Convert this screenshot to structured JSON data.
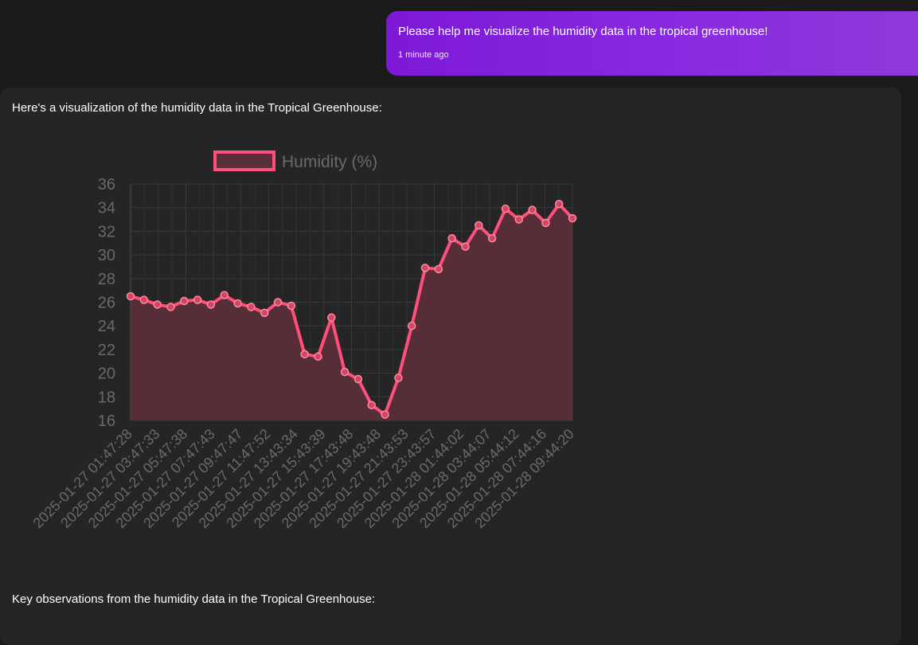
{
  "user_message": {
    "text": "Please help me visualize the humidity data in the tropical greenhouse!",
    "time": "1 minute ago"
  },
  "assistant_message": {
    "intro": "Here's a visualization of the humidity data in the Tropical Greenhouse:",
    "outro": "Key observations from the humidity data in the Tropical Greenhouse:"
  },
  "chart_data": {
    "type": "line",
    "fill": true,
    "colors": {
      "line": "#ff4f7a",
      "fill": "#5a2e38",
      "grid": "#383838",
      "tick": "#6a6a6a"
    },
    "legend": {
      "position": "top",
      "label": "Humidity (%)"
    },
    "ylim": [
      16,
      36
    ],
    "yticks": [
      16,
      18,
      20,
      22,
      24,
      26,
      28,
      30,
      32,
      34,
      36
    ],
    "xtick_labels": [
      "2025-01-27 01:47:28",
      "2025-01-27 03:47:33",
      "2025-01-27 05:47:38",
      "2025-01-27 07:47:43",
      "2025-01-27 09:47:47",
      "2025-01-27 11:47:52",
      "2025-01-27 13:43:34",
      "2025-01-27 15:43:39",
      "2025-01-27 17:43:48",
      "2025-01-27 19:43:48",
      "2025-01-27 21:43:53",
      "2025-01-27 23:43:57",
      "2025-01-28 01:44:02",
      "2025-01-28 03:44:07",
      "2025-01-28 05:44:12",
      "2025-01-28 07:44:16",
      "2025-01-28 09:44:20"
    ],
    "series": [
      {
        "name": "Humidity (%)",
        "values": [
          26.5,
          26.2,
          25.8,
          25.6,
          26.1,
          26.2,
          25.8,
          26.6,
          25.9,
          25.6,
          25.1,
          26.0,
          25.7,
          21.6,
          21.4,
          24.7,
          20.1,
          19.5,
          17.3,
          16.5,
          19.6,
          24.0,
          28.9,
          28.8,
          31.4,
          30.7,
          32.5,
          31.4,
          33.9,
          33.0,
          33.8,
          32.7,
          34.3,
          33.1
        ]
      }
    ]
  }
}
